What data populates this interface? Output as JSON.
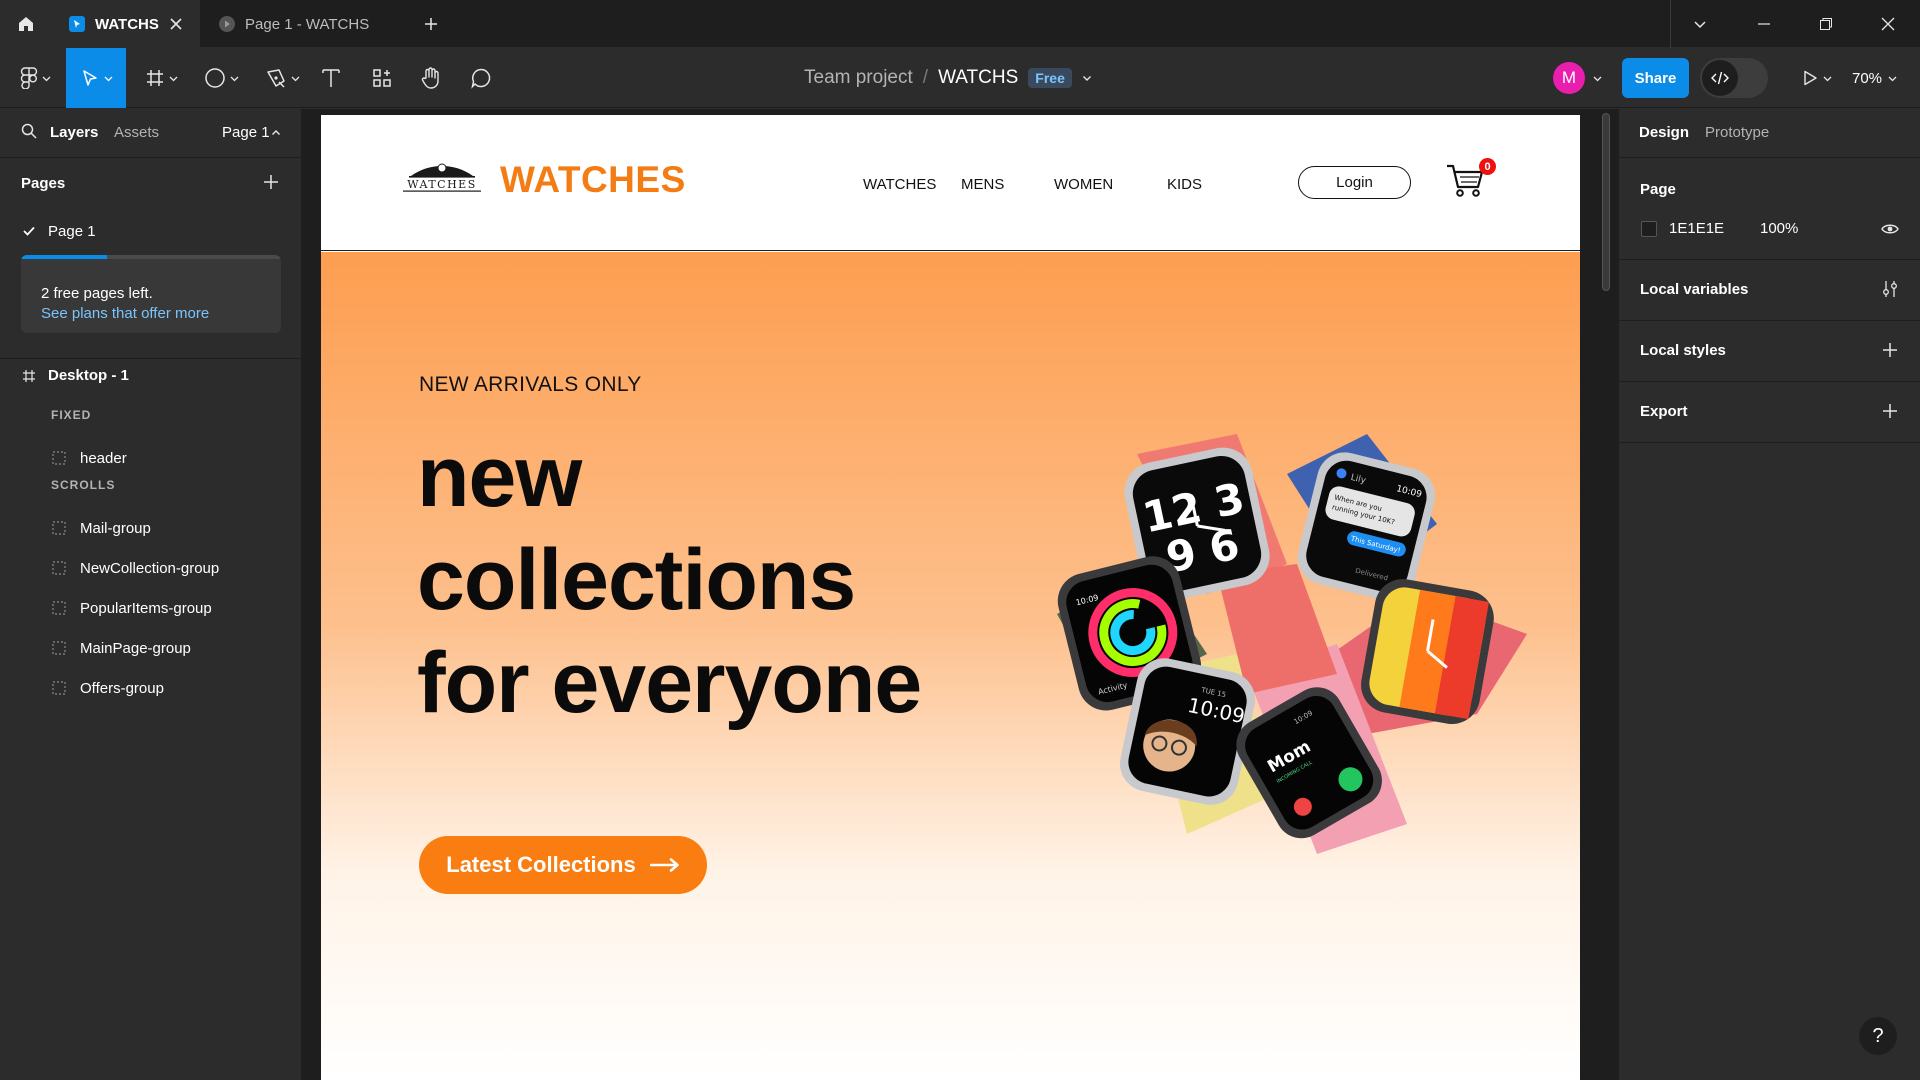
{
  "app": {
    "tabs": [
      {
        "label": "WATCHS",
        "active": true
      },
      {
        "label": "Page 1 - WATCHS",
        "active": false
      }
    ]
  },
  "toolbar": {
    "team": "Team project",
    "separator": "/",
    "file_name": "WATCHS",
    "plan_badge": "Free",
    "avatar_initial": "M",
    "avatar_color": "#e91eae",
    "share_label": "Share",
    "zoom": "70%",
    "accent": "#0c8ce9"
  },
  "left_panel": {
    "tabs": [
      "Layers",
      "Assets"
    ],
    "current_page": "Page 1",
    "pages_title": "Pages",
    "pages": [
      "Page 1"
    ],
    "quota_text": "2 free pages left.",
    "quota_link": "See plans that offer more",
    "quota_progress": 0.33,
    "frame_name": "Desktop - 1",
    "sections": [
      "FIXED",
      "SCROLLS"
    ],
    "fixed_layers": [
      "header"
    ],
    "scroll_layers": [
      "Mail-group",
      "NewCollection-group",
      "PopularItems-group",
      "MainPage-group",
      "Offers-group"
    ]
  },
  "site": {
    "logo_word": "WATCHES",
    "brand": "WATCHES",
    "brand_color": "#f47c14",
    "nav": [
      "WATCHES",
      "MENS",
      "WOMEN",
      "KIDS"
    ],
    "login": "Login",
    "cart_count": "0",
    "hero": {
      "kicker": "NEW ARRIVALS ONLY",
      "lines": [
        "new",
        "collections",
        "for everyone"
      ],
      "cta": "Latest Collections",
      "cta_color": "#f97d10"
    },
    "watch_faces": {
      "big_numerals": "12 3 9 6",
      "message_title": "Lily",
      "message_time": "10:09",
      "message_text": "When are you running your 10K?",
      "message_reply": "This Saturday!",
      "message_status": "Delivered",
      "activity_time": "10:09",
      "activity_label": "Activity",
      "memoji_date": "TUE 15",
      "memoji_time": "10:09",
      "call_time": "10:09",
      "call_name": "Mom",
      "call_label": "INCOMING CALL"
    }
  },
  "right_panel": {
    "tabs": [
      "Design",
      "Prototype"
    ],
    "page_title": "Page",
    "page_color": "1E1E1E",
    "page_opacity": "100%",
    "sections": [
      "Local variables",
      "Local styles",
      "Export"
    ],
    "help": "?"
  }
}
